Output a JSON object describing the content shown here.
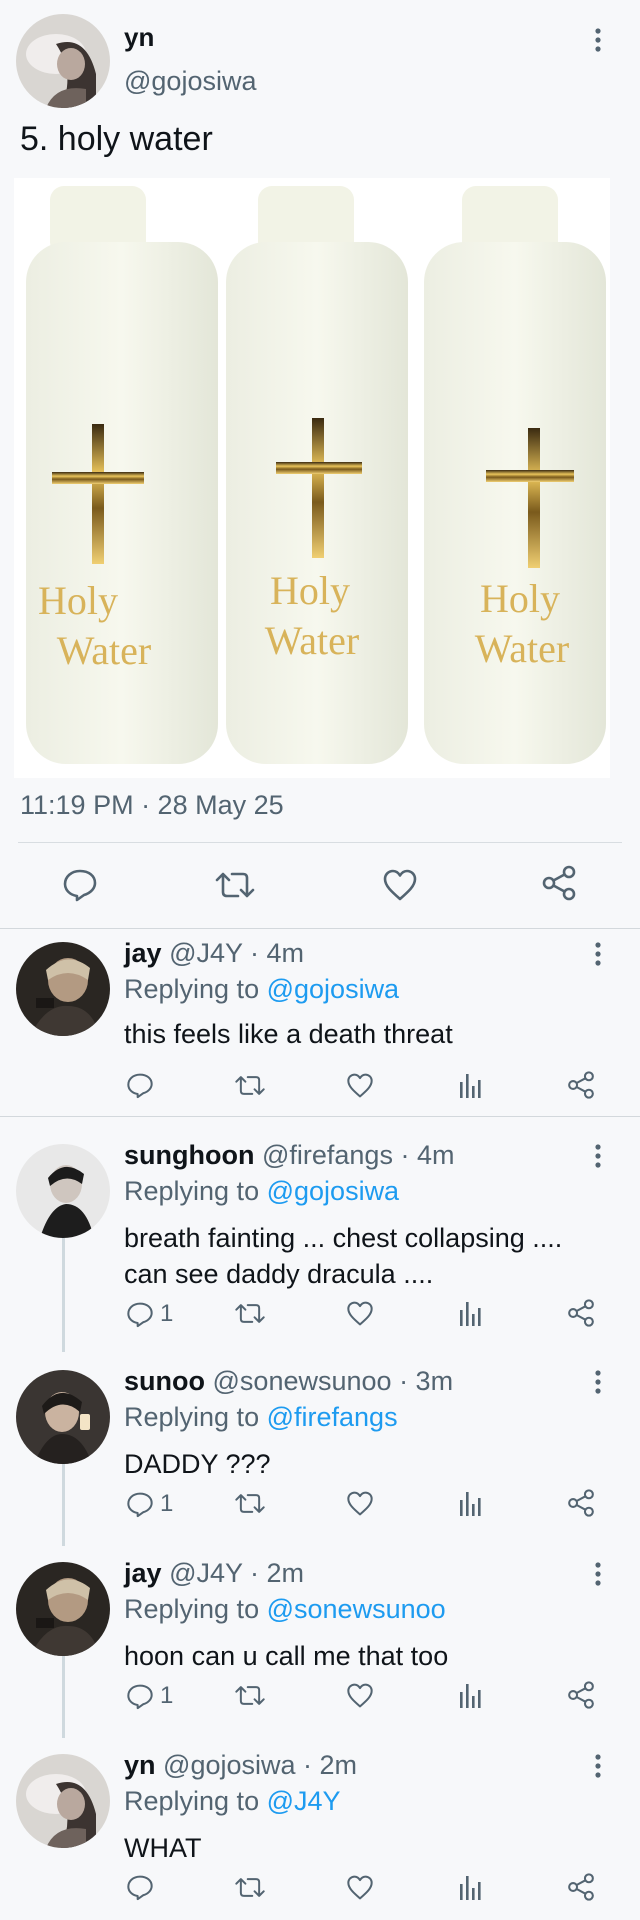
{
  "main": {
    "author_name": "yn",
    "author_handle": "@gojosiwa",
    "text": "5. holy water",
    "bottle_label_line1": "Holy",
    "bottle_label_line2": "Water",
    "timestamp": "11:19 PM · 28 May 25"
  },
  "replies": [
    {
      "name": "jay",
      "handle": "@J4Y",
      "time": "· 4m",
      "replying_prefix": "Replying to",
      "replying_to": "@gojosiwa",
      "text_line1": "this feels like a death threat",
      "text_line2": "",
      "reply_count": ""
    },
    {
      "name": "sunghoon",
      "handle": "@firefangs",
      "time": "· 4m",
      "replying_prefix": "Replying to",
      "replying_to": "@gojosiwa",
      "text_line1": "breath fainting ... chest collapsing ....",
      "text_line2": "can see daddy dracula ....",
      "reply_count": "1"
    },
    {
      "name": "sunoo",
      "handle": "@sonewsunoo",
      "time": "· 3m",
      "replying_prefix": "Replying to",
      "replying_to": "@firefangs",
      "text_line1": "DADDY ???",
      "text_line2": "",
      "reply_count": "1"
    },
    {
      "name": "jay",
      "handle": "@J4Y",
      "time": "· 2m",
      "replying_prefix": "Replying to",
      "replying_to": "@sonewsunoo",
      "text_line1": "hoon can u call me that too",
      "text_line2": "",
      "reply_count": "1"
    },
    {
      "name": "yn",
      "handle": "@gojosiwa",
      "time": "· 2m",
      "replying_prefix": "Replying to",
      "replying_to": "@J4Y",
      "text_line1": "WHAT",
      "text_line2": "",
      "reply_count": ""
    }
  ],
  "icons": {
    "reply": "reply-icon",
    "retweet": "retweet-icon",
    "like": "heart-icon",
    "views": "analytics-icon",
    "share": "share-icon",
    "more": "more-vertical-icon"
  },
  "colors": {
    "link": "#1d9bf0",
    "muted": "#536471",
    "background": "#f7f8fa",
    "cross_gold": "#c9a227"
  }
}
